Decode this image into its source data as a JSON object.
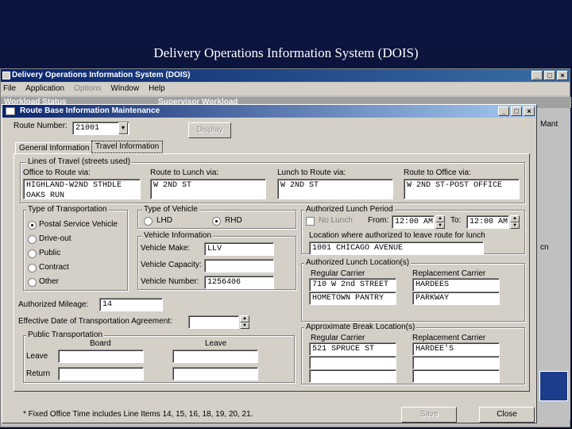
{
  "slide": {
    "title": "Delivery Operations Information System (DOIS)"
  },
  "app": {
    "title": "Delivery Operations Information System (DOIS)",
    "menu": [
      "File",
      "Application",
      "Options",
      "Window",
      "Help"
    ],
    "bg_tab1": "Workload Status",
    "bg_tab2": "Supervisor Workload",
    "right_text1": "Mant",
    "right_text2": "cn"
  },
  "dialog": {
    "title": "Route Base Information Maintenance",
    "route_number_label": "Route Number:",
    "route_number_value": "21001",
    "display_button": "Display",
    "tabs": [
      "General Information",
      "Travel Information"
    ],
    "lines_of_travel": {
      "title": "Lines of Travel (streets used)",
      "office_to_route_label": "Office to Route via:",
      "office_to_route_value": "HIGHLAND-W2ND STHDLE\nOAKS RUN",
      "route_to_lunch_label": "Route to Lunch via:",
      "route_to_lunch_value": "W 2ND ST",
      "lunch_to_route_label": "Lunch to Route via:",
      "lunch_to_route_value": "W 2ND ST",
      "route_to_office_label": "Route to Office via:",
      "route_to_office_value": "W 2ND ST-POST OFFICE"
    },
    "transportation": {
      "title": "Type of Transportation",
      "options": [
        "Postal Service Vehicle",
        "Drive-out",
        "Public",
        "Contract",
        "Other"
      ]
    },
    "vehicle_type": {
      "title": "Type of Vehicle",
      "lhd": "LHD",
      "rhd": "RHD"
    },
    "vehicle_info": {
      "title": "Vehicle Information",
      "make_label": "Vehicle Make:",
      "make_value": "LLV",
      "capacity_label": "Vehicle Capacity:",
      "capacity_value": "",
      "number_label": "Vehicle Number:",
      "number_value": "1256406"
    },
    "authorized_mileage_label": "Authorized Mileage:",
    "authorized_mileage_value": "14",
    "effective_date_label": "Effective Date of Transportation Agreement:",
    "effective_date_value": "",
    "public_transport": {
      "title": "Public Transportation",
      "board": "Board",
      "leave_col": "Leave",
      "leave_row": "Leave",
      "return_row": "Return"
    },
    "lunch_period": {
      "title": "Authorized Lunch Period",
      "no_lunch": "No Lunch",
      "from_label": "From:",
      "from_value": "12:00 AM",
      "to_label": "To:",
      "to_value": "12:00 AM",
      "location_label": "Location where authorized to leave route for lunch",
      "location_value": "1001 CHICAGO AVENUE"
    },
    "lunch_locations": {
      "title": "Authorized Lunch Location(s)",
      "regular": "Regular Carrier",
      "replacement": "Replacement Carrier",
      "reg1": "710 W 2nd STREET",
      "rep1": "HARDEES",
      "reg2": "HOMETOWN PANTRY",
      "rep2": "PARKWAY"
    },
    "break_locations": {
      "title": "Approximate Break Location(s)",
      "regular": "Regular Carrier",
      "replacement": "Replacement Carrier",
      "reg1": "521 SPRUCE ST",
      "rep1": "HARDEE'S"
    },
    "footnote": "* Fixed Office Time includes Line Items 14, 15, 16, 18, 19, 20, 21.",
    "save_button": "Save",
    "close_button": "Close"
  }
}
